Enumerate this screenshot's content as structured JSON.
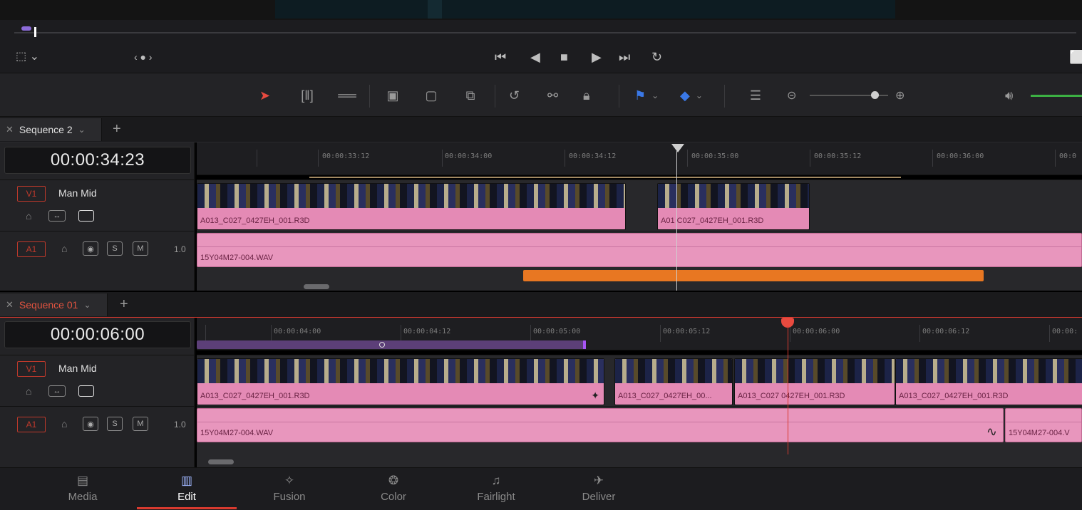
{
  "viewer": {},
  "transport": {
    "icons": [
      "viewer-options-icon",
      "jog-icon",
      "go-to-start-icon",
      "play-reverse-icon",
      "stop-icon",
      "play-icon",
      "go-to-end-icon",
      "loop-icon"
    ]
  },
  "toolbar": {
    "accent_color": "#e84a3f",
    "audio_level_color": "#3cb043"
  },
  "sequences": [
    {
      "tab_label": "Sequence 2",
      "tab_color": "#e0e0e0",
      "timecode": "00:00:34:23",
      "ruler_labels": [
        "00:00:33:12",
        "00:00:34:00",
        "00:00:34:12",
        "00:00:35:00",
        "00:00:35:12",
        "00:00:36:00",
        "00:0"
      ],
      "video_track": {
        "label": "V1",
        "name": "Man Mid"
      },
      "audio_track": {
        "label": "A1",
        "volume": "1.0",
        "solo": "S",
        "mute": "M"
      },
      "video_clips": [
        "A013_C027_0427EH_001.R3D",
        "A01  C027_0427EH_001.R3D"
      ],
      "audio_clips": [
        "15Y04M27-004.WAV"
      ]
    },
    {
      "tab_label": "Sequence 01",
      "tab_color": "#e0533f",
      "timecode": "00:00:06:00",
      "ruler_labels": [
        "00:00:04:00",
        "00:00:04:12",
        "00:00:05:00",
        "00:00:05:12",
        "00:00:06:00",
        "00:00:06:12",
        "00:00:"
      ],
      "video_track": {
        "label": "V1",
        "name": "Man Mid"
      },
      "audio_track": {
        "label": "A1",
        "volume": "1.0",
        "solo": "S",
        "mute": "M"
      },
      "video_clips": [
        "A013_C027_0427EH_001.R3D",
        "A013_C027_0427EH_00...",
        "A013_C027  0427EH_001.R3D",
        "A013_C027_0427EH_001.R3D"
      ],
      "audio_clips": [
        "15Y04M27-004.WAV",
        "15Y04M27-004.V"
      ]
    }
  ],
  "pages": [
    {
      "label": "Media",
      "icon": "media-page-icon"
    },
    {
      "label": "Edit",
      "icon": "edit-page-icon",
      "active": true
    },
    {
      "label": "Fusion",
      "icon": "fusion-page-icon"
    },
    {
      "label": "Color",
      "icon": "color-page-icon"
    },
    {
      "label": "Fairlight",
      "icon": "fairlight-page-icon"
    },
    {
      "label": "Deliver",
      "icon": "deliver-page-icon"
    }
  ]
}
